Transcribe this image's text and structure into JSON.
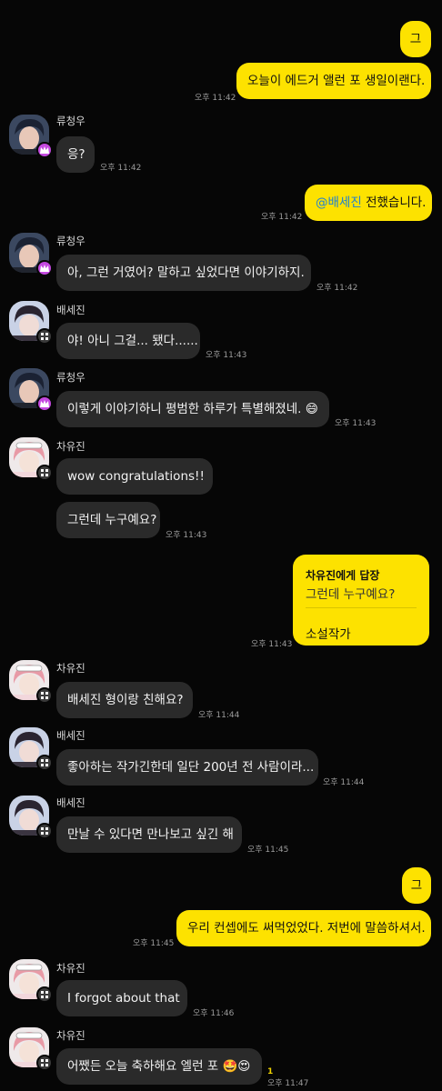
{
  "messages": [
    {
      "text": "그"
    },
    {
      "text": "오늘이 에드거 앨런 포 생일이랜다.",
      "time": "오후 11:42"
    },
    {
      "sender": "류청우",
      "text": "응?",
      "time": "오후 11:42"
    },
    {
      "mention": "@배세진",
      "text": "전했습니다.",
      "time": "오후 11:42"
    },
    {
      "sender": "류청우",
      "text": "아, 그런 거였어? 말하고 싶었다면 이야기하지.",
      "time": "오후 11:42"
    },
    {
      "sender": "배세진",
      "text": "야! 아니 그걸... 됐다......",
      "time": "오후 11:43"
    },
    {
      "sender": "류청우",
      "text": "이렇게 이야기하니 평범한 하루가 특별해졌네. 😄",
      "time": "오후 11:43"
    },
    {
      "sender": "차유진",
      "text": "wow congratulations!!"
    },
    {
      "text": "그런데 누구예요?",
      "time": "오후 11:43"
    },
    {
      "reply_title": "차유진에게 답장",
      "reply_quote": "그런데 누구예요?",
      "text": "소설작가",
      "time": "오후 11:43"
    },
    {
      "sender": "차유진",
      "text": "배세진 형이랑 친해요?",
      "time": "오후 11:44"
    },
    {
      "sender": "배세진",
      "text": "좋아하는 작가긴한데 일단 200년 전 사람이라...",
      "time": "오후 11:44"
    },
    {
      "sender": "배세진",
      "text": "만날 수 있다면 만나보고 싶긴 해",
      "time": "오후 11:45"
    },
    {
      "text": "그"
    },
    {
      "text": "우리 컨셉에도 써먹었었다. 저번에 말씀하셔서.",
      "time": "오후 11:45"
    },
    {
      "sender": "차유진",
      "text": "I forgot about that",
      "time": "오후 11:46"
    },
    {
      "sender": "차유진",
      "text": "어쨌든 오늘 축하해요 엘런 포 🤩😍",
      "time": "오후 11:47",
      "unread": "1"
    }
  ],
  "colors": {
    "background": "#060606",
    "incoming_bubble": "#2a2a2a",
    "outgoing_bubble": "#fde200",
    "mention": "#1c7fd6",
    "timestamp": "#9c9c9c"
  },
  "avatars": {
    "류청우": {
      "hair": "#1b2233",
      "skin": "#e8c8b8",
      "badge": "crown-icon"
    },
    "배세진": {
      "hair": "#2a2430",
      "skin": "#f0dcd6",
      "badge": "bot-icon"
    },
    "차유진": {
      "hair": "#e89aa6",
      "skin": "#f5e2d8",
      "badge": "bot-icon"
    }
  }
}
